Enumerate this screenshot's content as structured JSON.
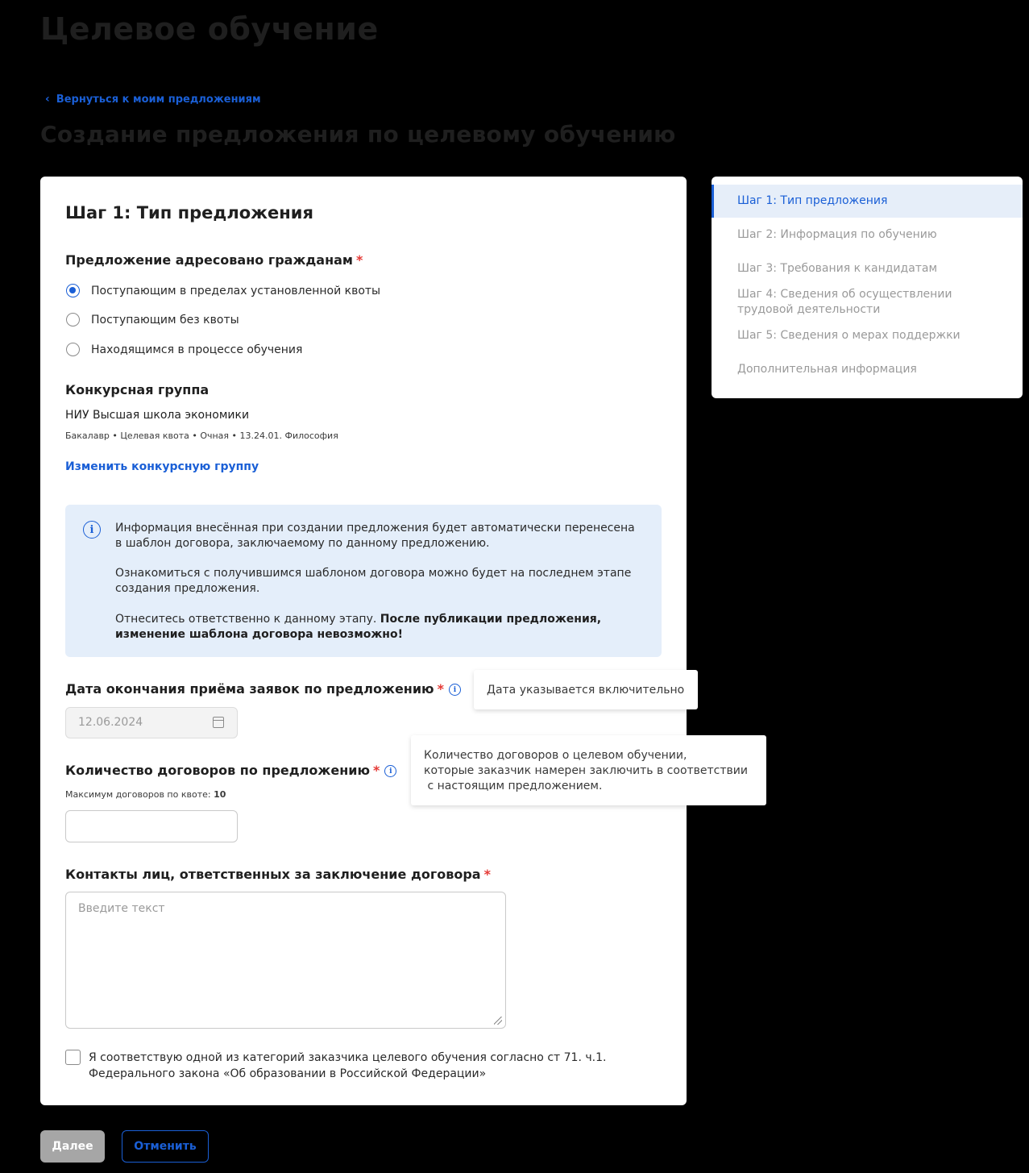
{
  "header": {
    "page_title": "Целевое обучение",
    "back_link": "Вернуться к моим предложениям",
    "sub_title": "Создание предложения по целевому обучению"
  },
  "form": {
    "step_title": "Шаг 1: Тип предложения",
    "addressed_label": "Предложение адресовано гражданам",
    "required_mark": "*",
    "radio_options": [
      {
        "label": "Поступающим в пределах установленной квоты",
        "checked": true
      },
      {
        "label": "Поступающим без квоты",
        "checked": false
      },
      {
        "label": "Находящимся в процессе обучения",
        "checked": false
      }
    ],
    "competition_group_label": "Конкурсная группа",
    "university": "НИУ Высшая школа экономики",
    "group_details": "Бакалавр • Целевая квота • Очная • 13.24.01. Философия",
    "change_group_link": "Изменить конкурсную группу",
    "info": {
      "p1": "Информация внесённая при создании предложения будет автоматически перенесена в шаблон договора, заключаемому по данному предложению.",
      "p2": "Ознакомиться с получившимся шаблоном договора можно будет на последнем этапе создания предложения.",
      "p3_plain": "Отнеситесь ответственно к данному этапу.",
      "p3_bold": "После публикации предложения, изменение шаблона договора невозможно!"
    },
    "deadline_label": "Дата окончания приёма заявок по предложению",
    "deadline_value": "12.06.2024",
    "deadline_tooltip": "Дата указывается включительно",
    "contracts_label": "Количество договоров по предложению",
    "contracts_hint_prefix": "Максимум договоров по квоте:",
    "contracts_hint_value": "10",
    "contracts_value": "",
    "contracts_tooltip_lines": [
      "Количество договоров о целевом обучении,",
      "которые заказчик намерен заключить в соответствии",
      " с настоящим предложением."
    ],
    "contacts_label": "Контакты лиц, ответственных за заключение договора",
    "contacts_placeholder": "Введите текст",
    "checkbox_line1": "Я соответствую одной из категорий заказчика целевого обучения согласно ст 71. ч.1.",
    "checkbox_line2": "Федерального закона «Об образовании в Российской Федерации»"
  },
  "sidebar": {
    "items": [
      {
        "label": "Шаг 1: Тип предложения",
        "active": true
      },
      {
        "label": "Шаг 2: Информация по обучению",
        "active": false
      },
      {
        "label": "Шаг 3: Требования к кандидатам",
        "active": false
      },
      {
        "label": "Шаг 4: Сведения об осуществлении трудовой деятельности",
        "active": false
      },
      {
        "label": "Шаг 5: Сведения о мерах поддержки",
        "active": false
      },
      {
        "label": "Дополнительная информация",
        "active": false
      }
    ]
  },
  "buttons": {
    "next": "Далее",
    "cancel": "Отменить"
  },
  "colors": {
    "accent": "#1a5fd6",
    "required": "#e53935",
    "info_bg": "#e4eefa",
    "disabled_button": "#a6a6a6"
  },
  "icons": [
    "chevron-left-icon",
    "info-icon",
    "calendar-icon",
    "resize-grip-icon"
  ]
}
